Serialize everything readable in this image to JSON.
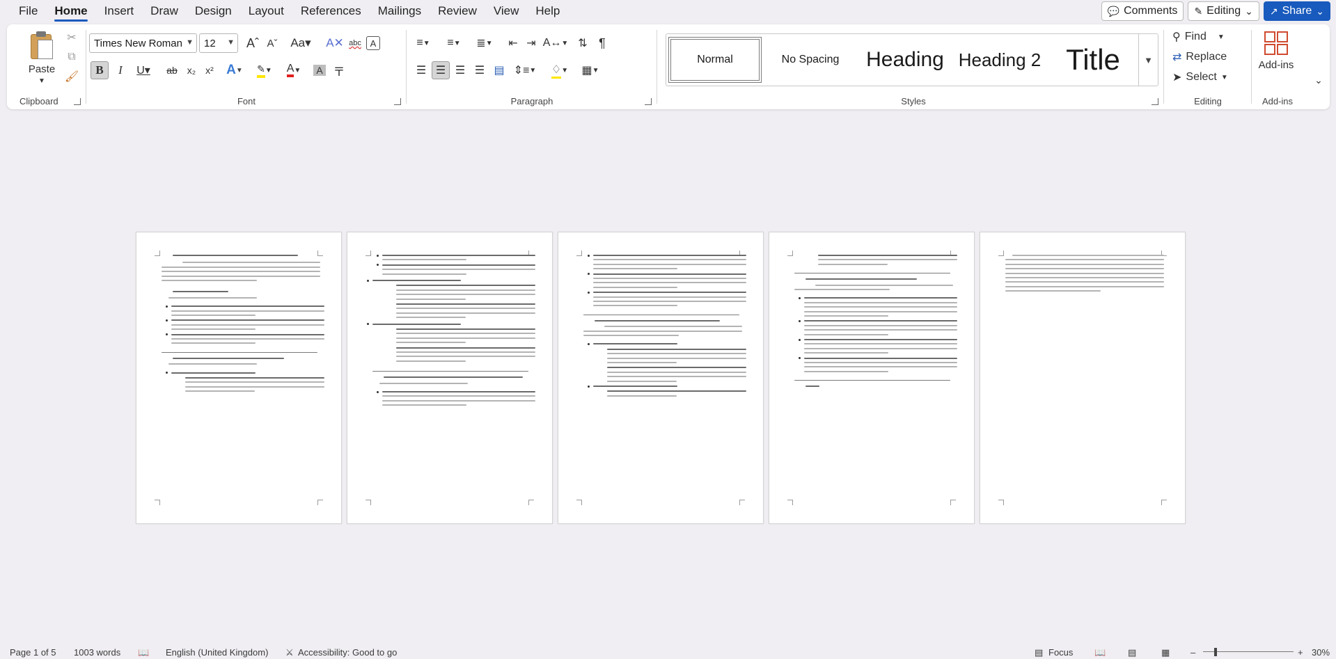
{
  "menu": {
    "tabs": [
      "File",
      "Home",
      "Insert",
      "Draw",
      "Design",
      "Layout",
      "References",
      "Mailings",
      "Review",
      "View",
      "Help"
    ],
    "active": "Home",
    "comments_label": "Comments",
    "editing_label": "Editing",
    "share_label": "Share"
  },
  "ribbon": {
    "clipboard": {
      "paste_label": "Paste",
      "group_label": "Clipboard"
    },
    "font": {
      "font_name": "Times New Roman",
      "font_size": "12",
      "group_label": "Font"
    },
    "paragraph": {
      "group_label": "Paragraph"
    },
    "styles": {
      "group_label": "Styles",
      "items": [
        "Normal",
        "No Spacing",
        "Heading",
        "Heading 2",
        "Title"
      ],
      "selected": "Normal"
    },
    "editing": {
      "find_label": "Find",
      "replace_label": "Replace",
      "select_label": "Select",
      "group_label": "Editing"
    },
    "addins": {
      "label": "Add-ins",
      "group_label": "Add-ins"
    }
  },
  "document": {
    "page_count": 5
  },
  "status": {
    "page": "Page 1 of 5",
    "words": "1003 words",
    "language": "English (United Kingdom)",
    "accessibility": "Accessibility: Good to go",
    "focus": "Focus",
    "zoom": "30%"
  },
  "colors": {
    "accent": "#185abd",
    "font_color": "#e02020",
    "highlight": "#ffe600"
  }
}
